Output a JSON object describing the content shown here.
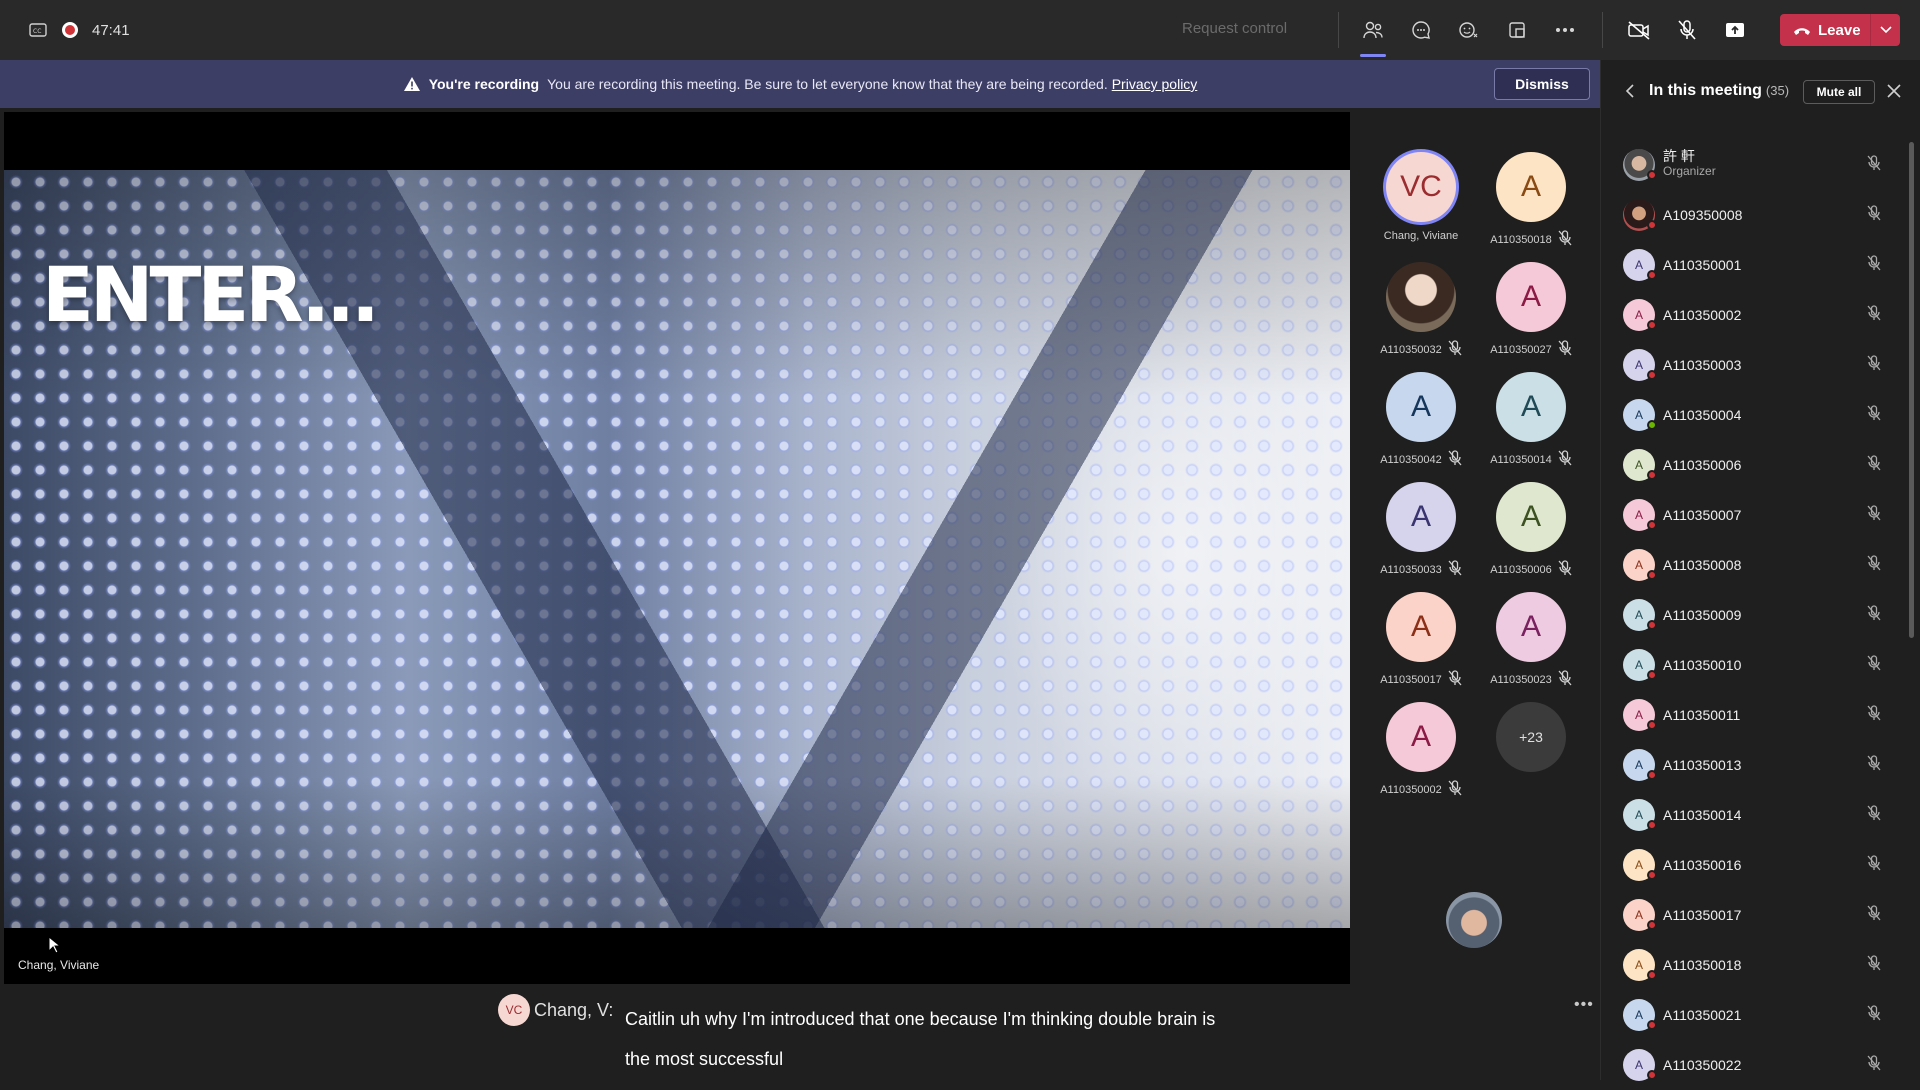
{
  "topbar": {
    "timer": "47:41",
    "request_control": "Request control",
    "leave_label": "Leave"
  },
  "banner": {
    "bold": "You're recording",
    "text": "You are recording this meeting. Be sure to let everyone know that they are being recorded.",
    "link": "Privacy policy",
    "dismiss": "Dismiss"
  },
  "stage": {
    "slide_title": "ENTER...",
    "presenter": "Chang, Viviane"
  },
  "gallery": {
    "tiles": [
      {
        "initials": "VC",
        "name": "Chang, Viviane",
        "bg": "#f7d7d2",
        "fg": "#9b2d30",
        "muted": false
      },
      {
        "initials": "A",
        "name": "A110350018",
        "bg": "#fde4c4",
        "fg": "#8a4a14",
        "muted": true
      },
      {
        "initials": "",
        "name": "A110350032",
        "bg": "photo",
        "fg": "#fff",
        "muted": true
      },
      {
        "initials": "A",
        "name": "A110350027",
        "bg": "#f6c9d8",
        "fg": "#8b1a44",
        "muted": true
      },
      {
        "initials": "A",
        "name": "A110350042",
        "bg": "#c7d8ee",
        "fg": "#16365c",
        "muted": true
      },
      {
        "initials": "A",
        "name": "A110350014",
        "bg": "#cbdfe6",
        "fg": "#1f4a56",
        "muted": true
      },
      {
        "initials": "A",
        "name": "A110350033",
        "bg": "#d6d3ec",
        "fg": "#3a3470",
        "muted": true
      },
      {
        "initials": "A",
        "name": "A110350006",
        "bg": "#dfe8cf",
        "fg": "#3c5222",
        "muted": true
      },
      {
        "initials": "A",
        "name": "A110350017",
        "bg": "#fbd3c8",
        "fg": "#8c2f18",
        "muted": true
      },
      {
        "initials": "A",
        "name": "A110350023",
        "bg": "#efcbe2",
        "fg": "#7a2160",
        "muted": true
      },
      {
        "initials": "A",
        "name": "A110350002",
        "bg": "#f6c9d8",
        "fg": "#8b1a44",
        "muted": true
      }
    ],
    "more": "+23"
  },
  "captions": {
    "avatar": "VC",
    "speaker": "Chang, V:",
    "text": "Caitlin uh why I'm introduced that one because I'm thinking double brain is the most successful"
  },
  "panel": {
    "title": "In this meeting",
    "count": "(35)",
    "mute_all": "Mute all",
    "participants": [
      {
        "name": "許 軒",
        "role": "Organizer",
        "avatar": "photo1",
        "letter": "",
        "bg": "",
        "fg": "",
        "status": "red"
      },
      {
        "name": "A109350008",
        "role": "",
        "avatar": "photo2",
        "letter": "",
        "bg": "",
        "fg": "",
        "status": "red"
      },
      {
        "name": "A110350001",
        "role": "",
        "avatar": "letter",
        "letter": "A",
        "bg": "#d6d3ec",
        "fg": "#3a3470",
        "status": "red"
      },
      {
        "name": "A110350002",
        "role": "",
        "avatar": "letter",
        "letter": "A",
        "bg": "#f6c9d8",
        "fg": "#8b1a44",
        "status": "red"
      },
      {
        "name": "A110350003",
        "role": "",
        "avatar": "letter",
        "letter": "A",
        "bg": "#d6d3ec",
        "fg": "#3a3470",
        "status": "red"
      },
      {
        "name": "A110350004",
        "role": "",
        "avatar": "letter",
        "letter": "A",
        "bg": "#c7d8ee",
        "fg": "#16365c",
        "status": "green"
      },
      {
        "name": "A110350006",
        "role": "",
        "avatar": "letter",
        "letter": "A",
        "bg": "#dfe8cf",
        "fg": "#3c5222",
        "status": "red"
      },
      {
        "name": "A110350007",
        "role": "",
        "avatar": "letter",
        "letter": "A",
        "bg": "#f6c9d8",
        "fg": "#8b1a44",
        "status": "red"
      },
      {
        "name": "A110350008",
        "role": "",
        "avatar": "letter",
        "letter": "A",
        "bg": "#fbd3c8",
        "fg": "#8c2f18",
        "status": "red"
      },
      {
        "name": "A110350009",
        "role": "",
        "avatar": "letter",
        "letter": "A",
        "bg": "#cbdfe6",
        "fg": "#1f4a56",
        "status": "red"
      },
      {
        "name": "A110350010",
        "role": "",
        "avatar": "letter",
        "letter": "A",
        "bg": "#cbdfe6",
        "fg": "#1f4a56",
        "status": "red"
      },
      {
        "name": "A110350011",
        "role": "",
        "avatar": "letter",
        "letter": "A",
        "bg": "#f6c9d8",
        "fg": "#8b1a44",
        "status": "red"
      },
      {
        "name": "A110350013",
        "role": "",
        "avatar": "letter",
        "letter": "A",
        "bg": "#c7d8ee",
        "fg": "#16365c",
        "status": "red"
      },
      {
        "name": "A110350014",
        "role": "",
        "avatar": "letter",
        "letter": "A",
        "bg": "#cbdfe6",
        "fg": "#1f4a56",
        "status": "red"
      },
      {
        "name": "A110350016",
        "role": "",
        "avatar": "letter",
        "letter": "A",
        "bg": "#fde4c4",
        "fg": "#8a4a14",
        "status": "red"
      },
      {
        "name": "A110350017",
        "role": "",
        "avatar": "letter",
        "letter": "A",
        "bg": "#fbd3c8",
        "fg": "#8c2f18",
        "status": "red"
      },
      {
        "name": "A110350018",
        "role": "",
        "avatar": "letter",
        "letter": "A",
        "bg": "#fde4c4",
        "fg": "#8a4a14",
        "status": "red"
      },
      {
        "name": "A110350021",
        "role": "",
        "avatar": "letter",
        "letter": "A",
        "bg": "#c7d8ee",
        "fg": "#16365c",
        "status": "red"
      },
      {
        "name": "A110350022",
        "role": "",
        "avatar": "letter",
        "letter": "A",
        "bg": "#d6d3ec",
        "fg": "#3a3470",
        "status": "red"
      }
    ]
  }
}
